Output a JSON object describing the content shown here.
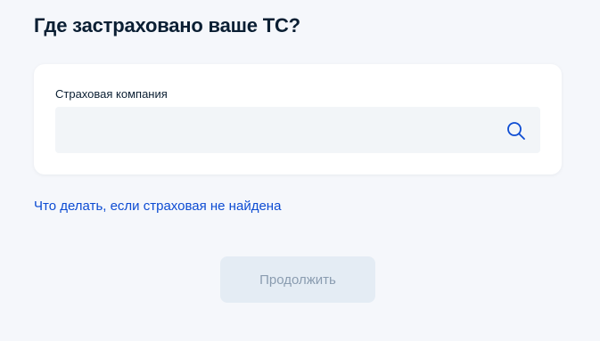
{
  "page": {
    "title": "Где застраховано ваше ТС?"
  },
  "insurance_field": {
    "label": "Страховая компания",
    "value": "",
    "placeholder": "",
    "icon": "search-icon"
  },
  "help_link": {
    "text": "Что делать, если страховая не найдена"
  },
  "actions": {
    "continue_label": "Продолжить",
    "continue_disabled": true
  },
  "colors": {
    "background": "#f5f7fb",
    "link": "#0d4cd3",
    "title": "#0b1f33",
    "input_bg": "#f2f5f8",
    "button_disabled_bg": "#e4ecf4",
    "button_disabled_text": "#8a9cb0"
  }
}
